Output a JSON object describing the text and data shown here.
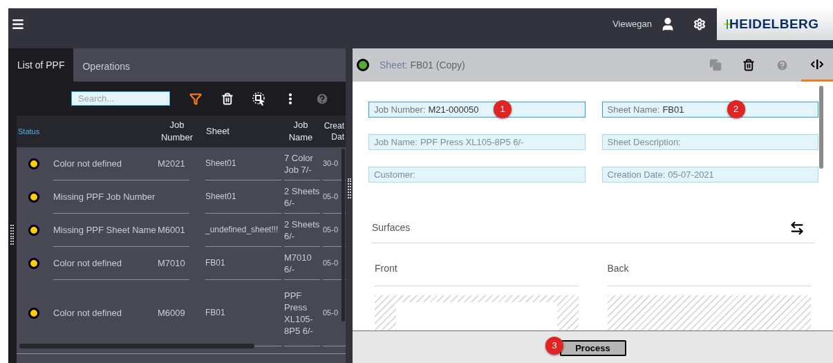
{
  "header": {
    "user": "Viewegan",
    "logo": "HEIDELBERG"
  },
  "left_panel": {
    "tabs": [
      {
        "label": "List of PPF",
        "selected": true
      },
      {
        "label": "Operations",
        "selected": false
      }
    ],
    "search": {
      "placeholder": "Search..."
    },
    "table": {
      "columns": [
        "Status",
        "Job Number",
        "Sheet",
        "Job Name",
        "Creat Dat"
      ],
      "rows": [
        {
          "status": "Color not defined",
          "color": "#ffcc00",
          "job_number": "M2021",
          "sheet": "Sheet01",
          "job_name": "7 Color Job 7/-",
          "date": "30-0"
        },
        {
          "status": "Missing PPF Job Number",
          "color": "#ffcc00",
          "sheet": "Sheet01",
          "job_name": "2 Sheets 6/-",
          "date": "05-0"
        },
        {
          "status": "Missing PPF Sheet Name",
          "color": "#ffcc00",
          "job_number": "M6001",
          "sheet": "_undefined_sheet!!!",
          "job_name": "2 Sheets 6/-",
          "date": "05-0"
        },
        {
          "status": "Color not defined",
          "color": "#ffcc00",
          "job_number": "M7010",
          "sheet": "FB01",
          "job_name": "M7010 6/-",
          "date": "05-0"
        },
        {
          "status": "Color not defined",
          "color": "#ffcc00",
          "job_number": "M6009",
          "sheet": "FB01",
          "job_name": "PPF Press XL105-8P5 6/-",
          "date": "05-0"
        }
      ]
    }
  },
  "detail": {
    "status_ok": true,
    "title_label": "Sheet:",
    "title": "FB01 (Copy)",
    "fields": [
      {
        "label": "Job Number:",
        "value": "M21-000050",
        "disabled": false,
        "marker": "1"
      },
      {
        "label": "Sheet Name:",
        "value": "FB01",
        "disabled": false,
        "marker": "2"
      },
      {
        "label": "Job Name:",
        "value": "PPF Press XL105-8P5 6/-",
        "disabled": true
      },
      {
        "label": "Sheet Description:",
        "disabled": true
      },
      {
        "label": "Customer:",
        "disabled": true
      },
      {
        "label": "Creation Date:",
        "value": "05-07-2021",
        "disabled": true
      }
    ],
    "section": "Surfaces",
    "surfaces": [
      {
        "label": "Front",
        "kind": "framed"
      },
      {
        "label": "Back",
        "kind": "hatched"
      }
    ],
    "process_button": {
      "label": "Process",
      "marker": "3"
    }
  }
}
